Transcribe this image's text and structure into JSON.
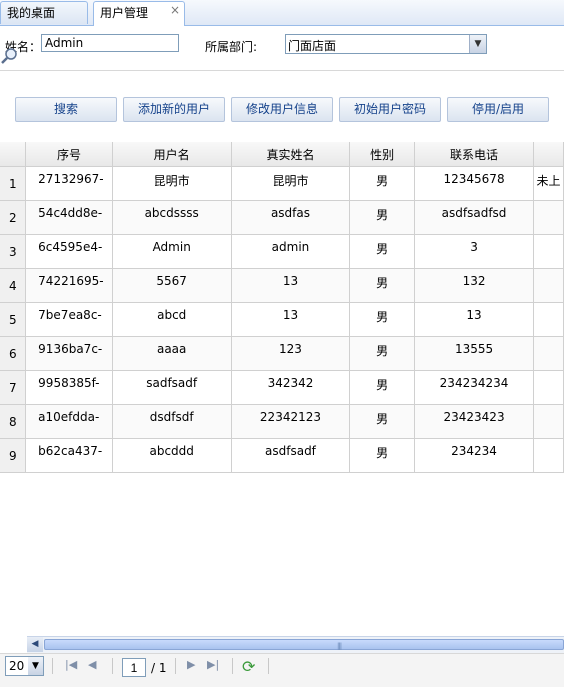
{
  "tabs": [
    {
      "label": "我的桌面"
    },
    {
      "label": "用户管理",
      "close": "×"
    }
  ],
  "form": {
    "name_label": "姓名：",
    "name_value": "Admin",
    "dept_label": "所属部门:",
    "dept_value": "门面店面",
    "search_icon": "magnifier-icon"
  },
  "buttons": {
    "search": "搜索",
    "add_user": "添加新的用户",
    "edit_user": "修改用户信息",
    "init_password": "初始用户密码",
    "toggle_enable": "停用/启用"
  },
  "table": {
    "columns": [
      "序号",
      "用户名",
      "真实姓名",
      "性别",
      "联系电话"
    ],
    "rows": [
      {
        "n": "1",
        "id": "27132967-",
        "username": "昆明市",
        "realname": "昆明市",
        "gender": "男",
        "phone": "12345678",
        "extra": "未上"
      },
      {
        "n": "2",
        "id": "54c4dd8e-",
        "username": "abcdssss",
        "realname": "asdfas",
        "gender": "男",
        "phone": "asdfsadfsd",
        "extra": ""
      },
      {
        "n": "3",
        "id": "6c4595e4-",
        "username": "Admin",
        "realname": "admin",
        "gender": "男",
        "phone": "3",
        "extra": ""
      },
      {
        "n": "4",
        "id": "74221695-",
        "username": "5567",
        "realname": "13",
        "gender": "男",
        "phone": "132",
        "extra": ""
      },
      {
        "n": "5",
        "id": "7be7ea8c-",
        "username": "abcd",
        "realname": "13",
        "gender": "男",
        "phone": "13",
        "extra": ""
      },
      {
        "n": "6",
        "id": "9136ba7c-",
        "username": "aaaa",
        "realname": "123",
        "gender": "男",
        "phone": "13555",
        "extra": ""
      },
      {
        "n": "7",
        "id": "9958385f-",
        "username": "sadfsadf",
        "realname": "342342",
        "gender": "男",
        "phone": "234234234",
        "extra": ""
      },
      {
        "n": "8",
        "id": "a10efdda-",
        "username": "dsdfsdf",
        "realname": "22342123",
        "gender": "男",
        "phone": "23423423",
        "extra": ""
      },
      {
        "n": "9",
        "id": "b62ca437-",
        "username": "abcddd",
        "realname": "asdfsadf",
        "gender": "男",
        "phone": "234234",
        "extra": ""
      }
    ]
  },
  "pager": {
    "page_size": "20",
    "current_page": "1",
    "total_pages": "/ 1"
  }
}
